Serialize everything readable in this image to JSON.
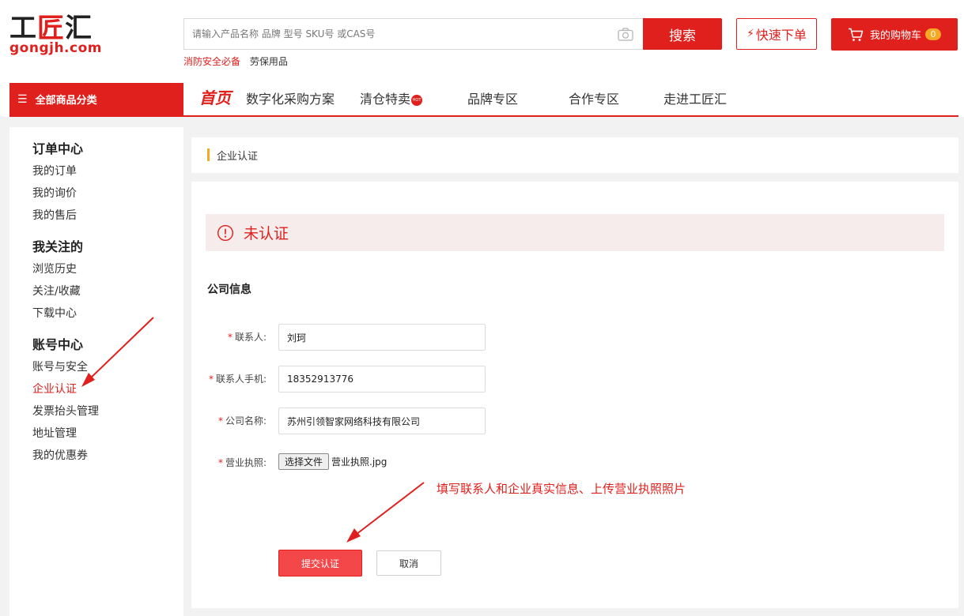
{
  "header": {
    "logo_cn_left": "工",
    "logo_cn_mid": "匠",
    "logo_cn_right": "汇",
    "logo_en": "gongjh.com",
    "search": {
      "placeholder": "请输入产品名称 品牌 型号 SKU号 或CAS号",
      "button_label": "搜索",
      "camera_icon": "camera-icon"
    },
    "hot_links": [
      "消防安全必备",
      "劳保用品"
    ],
    "quick_order_label": "快速下单",
    "cart_label": "我的购物车",
    "cart_count": "0"
  },
  "nav": {
    "all_categories": "全部商品分类",
    "items": [
      "首页",
      "数字化采购方案",
      "清仓特卖",
      "品牌专区",
      "合作专区",
      "走进工匠汇"
    ],
    "hot_badge": "HOT"
  },
  "sidebar": {
    "groups": [
      {
        "title": "订单中心",
        "items": [
          "我的订单",
          "我的询价",
          "我的售后"
        ]
      },
      {
        "title": "我关注的",
        "items": [
          "浏览历史",
          "关注/收藏",
          "下载中心"
        ]
      },
      {
        "title": "账号中心",
        "items": [
          "账号与安全",
          "企业认证",
          "发票抬头管理",
          "地址管理",
          "我的优惠券"
        ]
      }
    ],
    "active_item": "企业认证"
  },
  "main": {
    "breadcrumb": "企业认证",
    "status": "未认证",
    "section_title": "公司信息",
    "form": {
      "contact_label": "联系人:",
      "contact_value": "刘珂",
      "phone_label": "联系人手机:",
      "phone_value": "18352913776",
      "company_label": "公司名称:",
      "company_value": "苏州引领智家网络科技有限公司",
      "license_label": "营业执照:",
      "file_button_label": "选择文件",
      "file_name": "营业执照.jpg",
      "required_mark": "*"
    },
    "annotation": "填写联系人和企业真实信息、上传营业执照照片",
    "submit_label": "提交认证",
    "cancel_label": "取消"
  },
  "colors": {
    "brand_red": "#e0201d",
    "accent_orange": "#f6a723",
    "banner_bg": "#f6eceb"
  }
}
